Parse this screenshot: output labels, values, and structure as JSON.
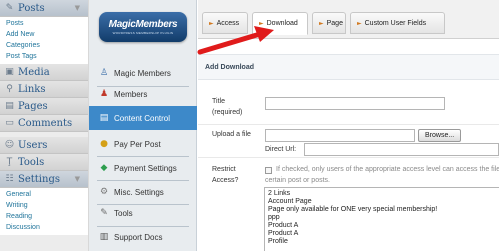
{
  "wp_sidebar": {
    "posts": {
      "icon": "pushpin-icon",
      "label": "Posts",
      "items": [
        "Posts",
        "Add New",
        "Categories",
        "Post Tags"
      ]
    },
    "media": {
      "icon": "media-icon",
      "label": "Media"
    },
    "links": {
      "icon": "link-icon",
      "label": "Links"
    },
    "pages": {
      "icon": "page-icon",
      "label": "Pages"
    },
    "comments": {
      "icon": "comment-icon",
      "label": "Comments"
    },
    "users": {
      "icon": "users-icon",
      "label": "Users"
    },
    "tools": {
      "icon": "tools-icon",
      "label": "Tools"
    },
    "settings": {
      "icon": "settings-icon",
      "label": "Settings",
      "items": [
        "General",
        "Writing",
        "Reading",
        "Discussion"
      ]
    }
  },
  "mm_panel": {
    "logo": {
      "title": "MagicMembers",
      "subtitle": "WORDPRESS MEMBERSHIP PLUGIN"
    },
    "items": [
      {
        "icon": "user-icon",
        "label": "Magic Members"
      },
      {
        "icon": "members-icon",
        "label": "Members"
      },
      {
        "icon": "document-icon",
        "label": "Content Control"
      },
      {
        "icon": "coins-icon",
        "label": "Pay Per Post"
      },
      {
        "icon": "diamond-icon",
        "label": "Payment Settings"
      },
      {
        "icon": "gear-icon",
        "label": "Misc. Settings"
      },
      {
        "icon": "wrench-icon",
        "label": "Tools"
      },
      {
        "icon": "docs-icon",
        "label": "Support Docs"
      }
    ],
    "active_index": 2
  },
  "tabs": [
    "Access",
    "Download",
    "Page",
    "Custom User Fields"
  ],
  "active_tab": "Download",
  "section_title": "Add Download",
  "form": {
    "title_label": "Title",
    "title_required": "(required)",
    "title_value": "",
    "upload_label": "Upload a file",
    "browse_label": "Browse...",
    "direct_url_label": "Direct Url:",
    "direct_url_value": "",
    "restrict_label_1": "Restrict",
    "restrict_label_2": "Access?",
    "restrict_hint_1": "If checked, only users of the appropriate access level can access the file,",
    "restrict_hint_2": "certain post or posts.",
    "restrict_checked": false,
    "access_options": [
      "2 Links",
      "Account Page",
      "Page only available for ONE very special membership!",
      "ppp",
      "Product A",
      "Product A",
      "Profile"
    ]
  },
  "colors": {
    "active_item": "#3d89c9",
    "link": "#21759b",
    "annotation_arrow": "#e01b1b",
    "logo": "#1f4f86"
  }
}
